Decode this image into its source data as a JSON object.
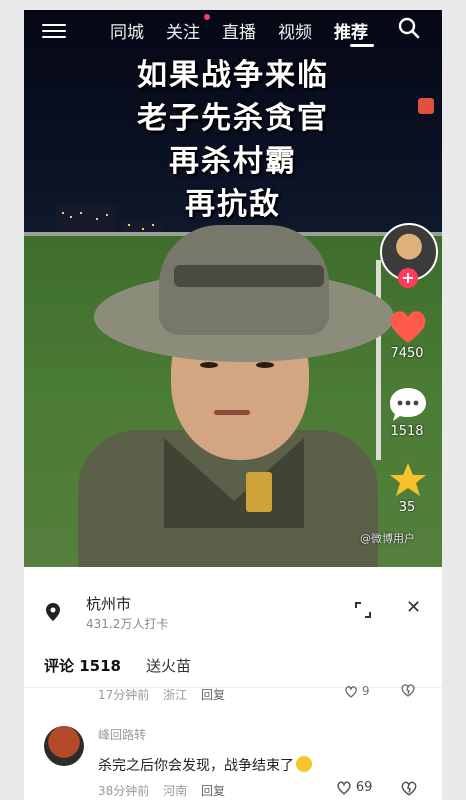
{
  "nav": {
    "tabs": [
      {
        "label": "同城"
      },
      {
        "label": "关注"
      },
      {
        "label": "直播"
      },
      {
        "label": "视频"
      },
      {
        "label": "推荐"
      }
    ]
  },
  "video": {
    "caption_lines": [
      "如果战争来临",
      "老子先杀贪官",
      "再杀村霸",
      "再抗敌"
    ],
    "likes": "7450",
    "comments": "1518",
    "favorites": "35",
    "watermark": "@微博用户"
  },
  "sheet": {
    "location_name": "杭州市",
    "location_sub": "431.2万人打卡",
    "tab_comments": "评论 1518",
    "tab_fire": "送火苗",
    "comment_prev": {
      "time": "17分钟前",
      "region": "浙江",
      "reply": "回复",
      "likes": "9"
    },
    "comment": {
      "user": "峰回路转",
      "text": "杀完之后你会发现，战争结束了",
      "time": "38分钟前",
      "region": "河南",
      "reply": "回复",
      "likes": "69"
    }
  },
  "colors": {
    "accent": "#ff3b5c",
    "like_red": "#ff5a4a",
    "star": "#f5c22b",
    "comment_bubble": "#ffffff"
  }
}
